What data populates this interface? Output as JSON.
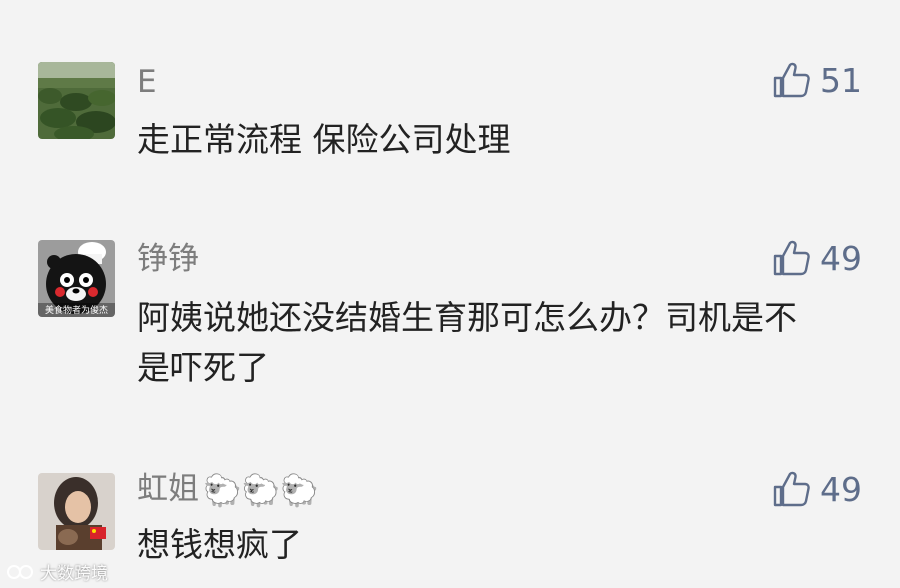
{
  "comments": [
    {
      "name": "E",
      "text": "走正常流程 保险公司处理",
      "likes": "51",
      "avatar": "field-photo"
    },
    {
      "name": "铮铮",
      "text": "阿姨说她还没结婚生育那可怎么办？司机是不是吓死了",
      "likes": "49",
      "avatar": "kumamon-chef",
      "avatar_caption": "美食物者为俊杰"
    },
    {
      "name": "虹姐",
      "name_emoji": "🐑🐑🐑",
      "text": "想钱想疯了",
      "likes": "49",
      "avatar": "portrait-photo"
    }
  ],
  "watermark": {
    "text": "大数跨境"
  },
  "colors": {
    "background": "#f3f3f3",
    "name": "#7d7d7d",
    "text": "#222222",
    "like": "#5e6d8a"
  }
}
